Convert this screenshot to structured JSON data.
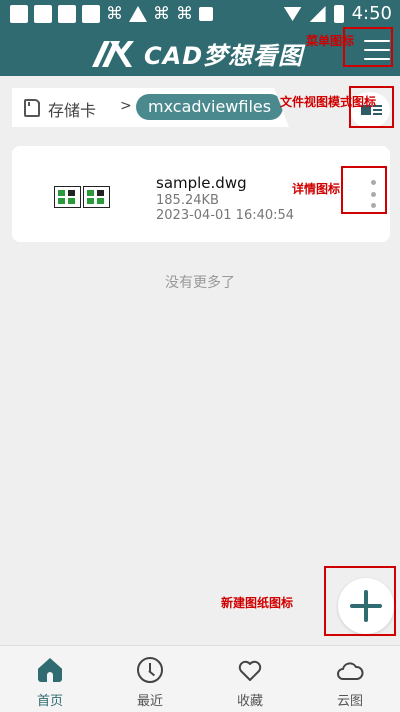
{
  "status_bar": {
    "time": "4:50"
  },
  "header": {
    "title": "CAD梦想看图",
    "menu_annotation": "菜单图标"
  },
  "breadcrumb": {
    "storage_label": "存储卡",
    "separator": ">",
    "current_folder": "mxcadviewfiles",
    "view_mode_annotation": "文件视图模式图标"
  },
  "file": {
    "name": "sample.dwg",
    "size": "185.24KB",
    "modified": "2023-04-01 16:40:54",
    "details_annotation": "详情图标"
  },
  "list_end_text": "没有更多了",
  "fab": {
    "annotation": "新建图纸图标"
  },
  "bottom_nav": {
    "items": [
      {
        "label": "首页",
        "icon": "home-icon",
        "active": true
      },
      {
        "label": "最近",
        "icon": "clock-icon",
        "active": false
      },
      {
        "label": "收藏",
        "icon": "heart-icon",
        "active": false
      },
      {
        "label": "云图",
        "icon": "cloud-icon",
        "active": false
      }
    ]
  },
  "colors": {
    "primary": "#2f6b70",
    "chip": "#4a8a8e",
    "background": "#efefef",
    "annotation": "#d00000"
  }
}
